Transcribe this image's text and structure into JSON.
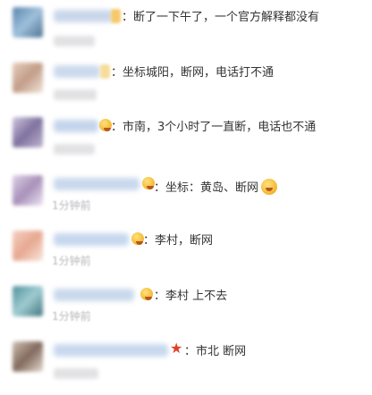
{
  "comments": [
    {
      "text": "：断了一下午了，一个官方解释都没有",
      "time": "",
      "avatar_color": "#5f8fb8",
      "badge": "square"
    },
    {
      "text": "：坐标城阳，断网，电话打不通",
      "time": "",
      "avatar_color": "#c9a287",
      "badge": "square"
    },
    {
      "text": "：市南，3个小时了一直断，电话也不通",
      "time": "",
      "avatar_color": "#7e6fa0",
      "badge": "face"
    },
    {
      "text": "：坐标：黄岛、断网",
      "time": "1分钟前",
      "avatar_color": "#9a7fae",
      "badge": "face",
      "trailing_emoji": "face-emoji"
    },
    {
      "text": "：李村，断网",
      "time": "1分钟前",
      "avatar_color": "#e6a08a",
      "badge": "face"
    },
    {
      "text": "：李村 上不去",
      "time": "1分钟前",
      "avatar_color": "#3f8f9d",
      "badge": "face"
    },
    {
      "text": "：市北 断网",
      "time": "",
      "avatar_color": "#8c7262",
      "badge": "star"
    }
  ]
}
